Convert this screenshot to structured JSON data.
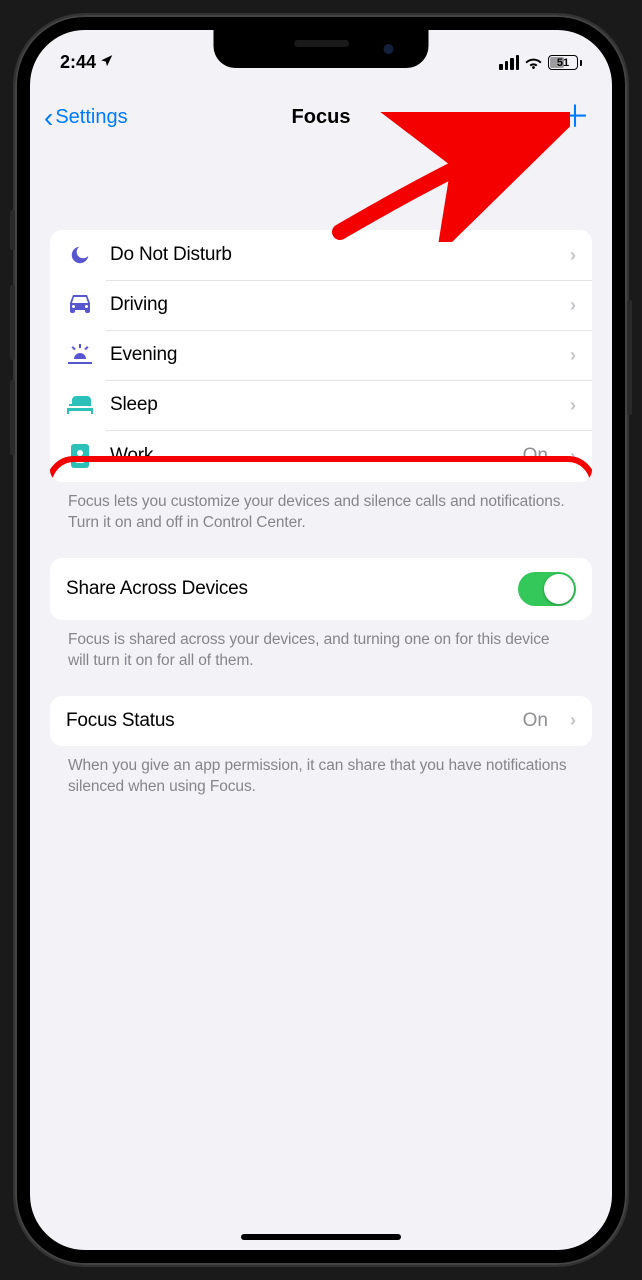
{
  "status_bar": {
    "time": "2:44",
    "battery_percent": "51"
  },
  "nav": {
    "back_label": "Settings",
    "title": "Focus",
    "add_glyph": "＋"
  },
  "focus_list": [
    {
      "icon": "moon",
      "label": "Do Not Disturb",
      "detail": "",
      "color": "purple"
    },
    {
      "icon": "car",
      "label": "Driving",
      "detail": "",
      "color": "purple"
    },
    {
      "icon": "sunset",
      "label": "Evening",
      "detail": "",
      "color": "purple"
    },
    {
      "icon": "bed",
      "label": "Sleep",
      "detail": "",
      "color": "teal"
    },
    {
      "icon": "badge",
      "label": "Work",
      "detail": "On",
      "color": "teal"
    }
  ],
  "focus_footer": "Focus lets you customize your devices and silence calls and notifications. Turn it on and off in Control Center.",
  "share_across": {
    "label": "Share Across Devices",
    "on": true,
    "footer": "Focus is shared across your devices, and turning one on for this device will turn it on for all of them."
  },
  "focus_status": {
    "label": "Focus Status",
    "detail": "On",
    "footer": "When you give an app permission, it can share that you have notifications silenced when using Focus."
  },
  "annotations": {
    "highlighted_row_index": 4,
    "arrow_pointing_to": "nav-add-button"
  }
}
